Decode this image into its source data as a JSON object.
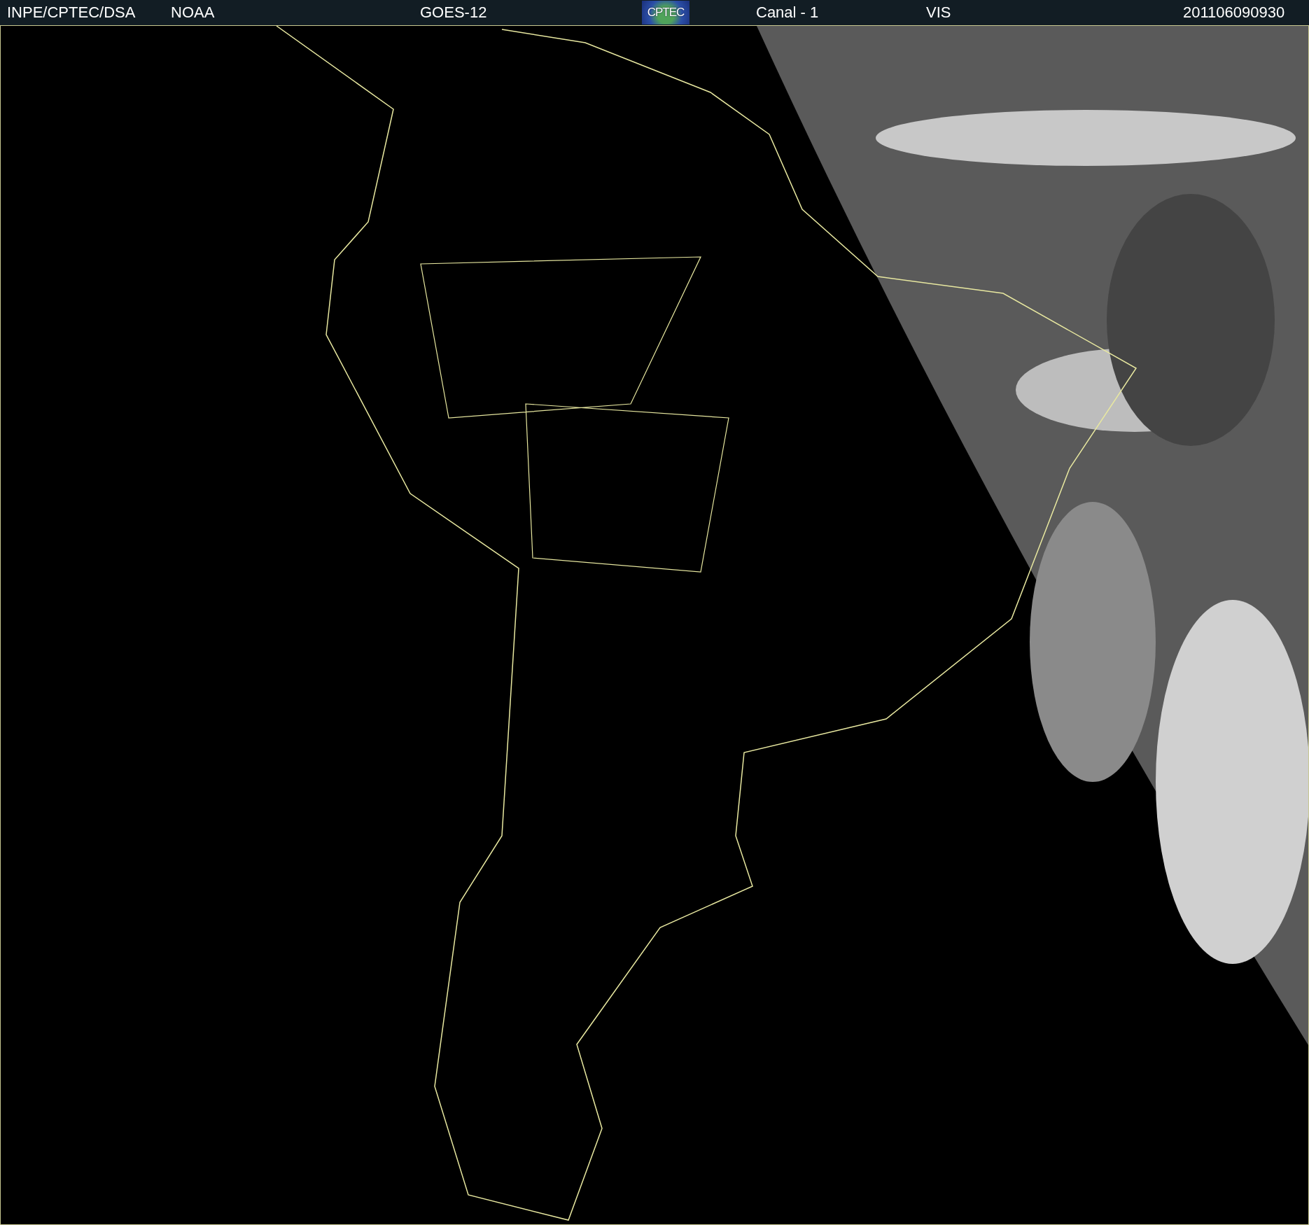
{
  "header": {
    "items": [
      {
        "kind": "text",
        "text": "INPE/CPTEC/DSA"
      },
      {
        "kind": "text",
        "text": "NOAA"
      },
      {
        "kind": "text",
        "text": "GOES-12"
      },
      {
        "kind": "logo",
        "text": "CPTEC"
      },
      {
        "kind": "text",
        "text": "Canal - 1"
      },
      {
        "kind": "text",
        "text": "VIS"
      },
      {
        "kind": "text",
        "text": "201106090930"
      }
    ]
  }
}
